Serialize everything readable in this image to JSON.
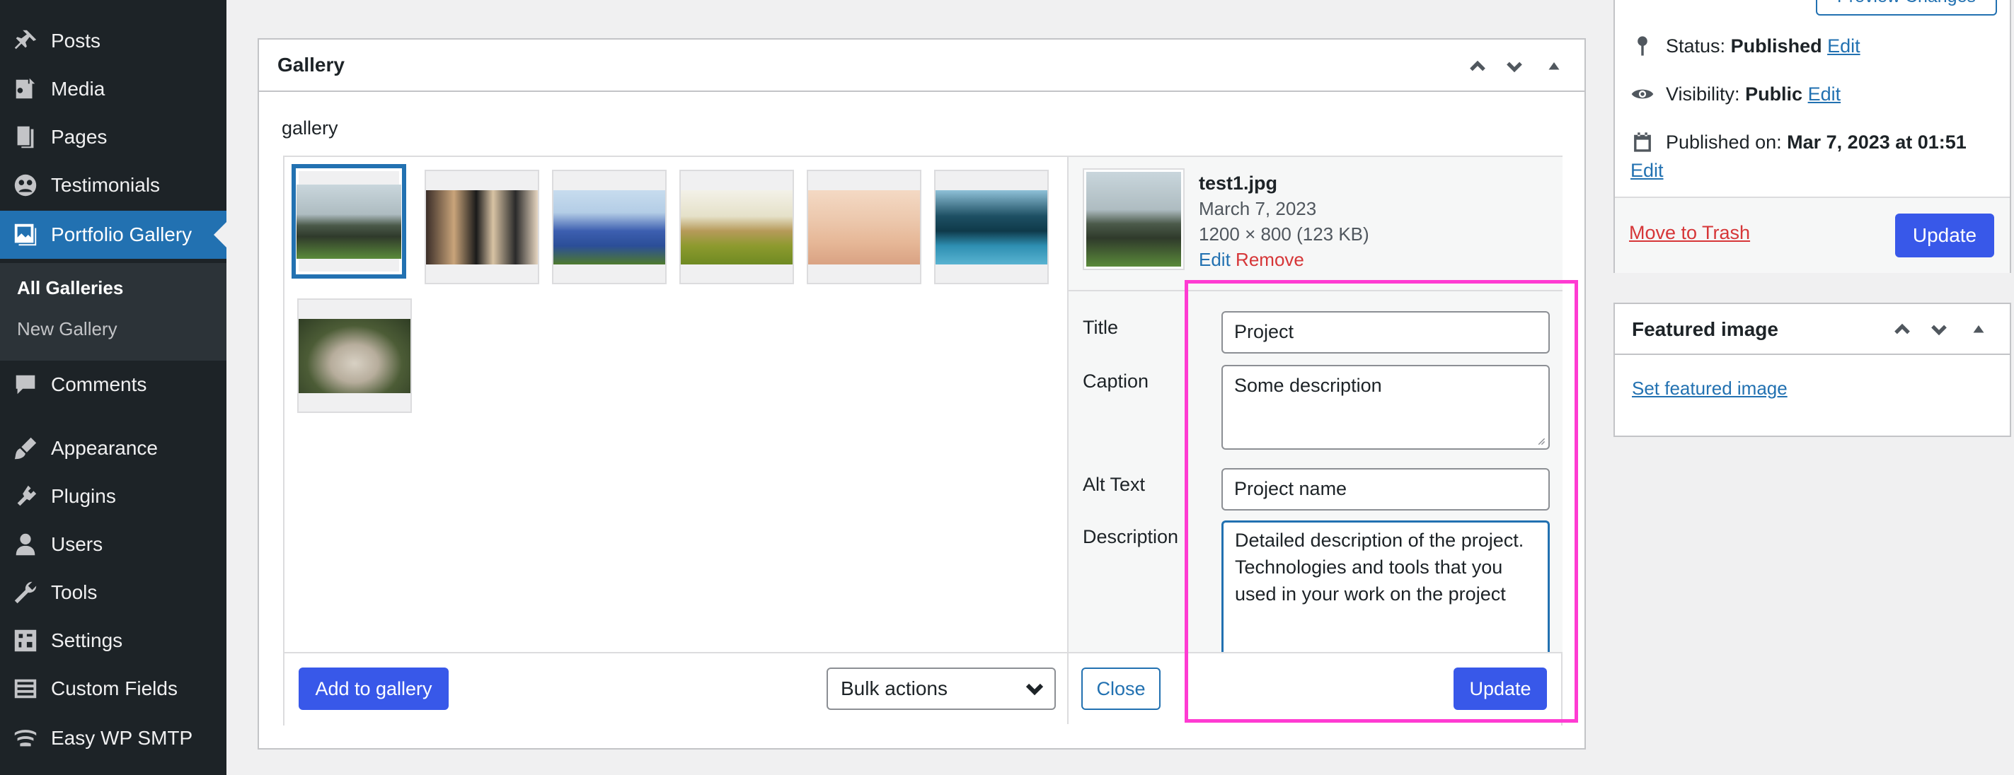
{
  "sidebar": {
    "items": [
      {
        "label": "Posts",
        "icon": "pin-icon"
      },
      {
        "label": "Media",
        "icon": "media-icon"
      },
      {
        "label": "Pages",
        "icon": "pages-icon"
      },
      {
        "label": "Testimonials",
        "icon": "testimonials-icon"
      },
      {
        "label": "Portfolio Gallery",
        "icon": "gallery-icon"
      },
      {
        "label": "Comments",
        "icon": "comments-icon"
      },
      {
        "label": "Appearance",
        "icon": "brush-icon"
      },
      {
        "label": "Plugins",
        "icon": "plugin-icon"
      },
      {
        "label": "Users",
        "icon": "user-icon"
      },
      {
        "label": "Tools",
        "icon": "wrench-icon"
      },
      {
        "label": "Settings",
        "icon": "settings-icon"
      },
      {
        "label": "Custom Fields",
        "icon": "fields-icon"
      },
      {
        "label": "Easy WP SMTP",
        "icon": "smtp-icon"
      }
    ],
    "submenu": {
      "all_galleries": "All Galleries",
      "new_gallery": "New Gallery"
    }
  },
  "gallery": {
    "title": "Gallery",
    "field_label": "gallery",
    "add_button": "Add to gallery",
    "bulk_actions": "Bulk actions",
    "thumbnails": [
      {
        "name": "rocks"
      },
      {
        "name": "cameras"
      },
      {
        "name": "flowers"
      },
      {
        "name": "tent"
      },
      {
        "name": "desert"
      },
      {
        "name": "lake-kayak"
      },
      {
        "name": "dog-blanket"
      }
    ]
  },
  "attachment": {
    "filename": "test1.jpg",
    "date": "March 7, 2023",
    "dimensions": "1200 × 800 (123 KB)",
    "edit_link": "Edit",
    "remove_link": "Remove",
    "title_label": "Title",
    "title_value": "Project",
    "caption_label": "Caption",
    "caption_value": "Some description",
    "alt_label": "Alt Text",
    "alt_value": "Project name",
    "description_label": "Description",
    "description_value": "Detailed description of the project. Technologies and tools that you used in your work on the project",
    "close_button": "Close",
    "update_button": "Update"
  },
  "publish": {
    "status_label": "Status:",
    "status_value": "Published",
    "status_edit": "Edit",
    "visibility_label": "Visibility:",
    "visibility_value": "Public",
    "visibility_edit": "Edit",
    "published_label": "Published on:",
    "published_value": "Mar 7, 2023 at 01:51",
    "published_edit": "Edit",
    "trash_link": "Move to Trash",
    "update_button": "Update",
    "preview_button": "Preview Changes"
  },
  "featured": {
    "title": "Featured image",
    "set_link": "Set featured image"
  },
  "colors": {
    "sidebar_bg": "#1d2327",
    "active_menu": "#2271b1",
    "primary_button": "#3858e9",
    "highlight_border": "#ff3bd2",
    "link_red": "#d63638"
  }
}
